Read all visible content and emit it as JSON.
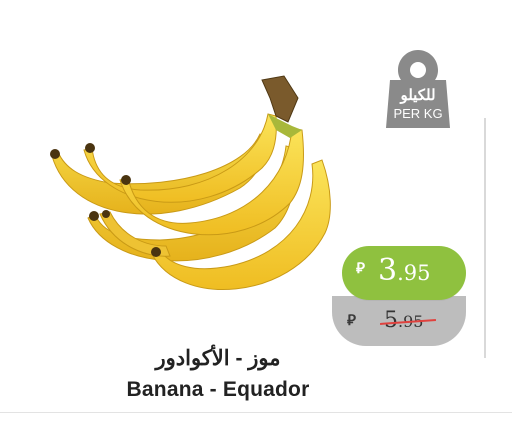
{
  "product": {
    "name_ar": "موز - الأكوادور",
    "name_en": "Banana - Equador",
    "image": "banana-bunch"
  },
  "unit_tag": {
    "label_ar": "للكيلو",
    "label_en": "PER KG",
    "icon": "weight-icon",
    "color": "#8a8a8a"
  },
  "price": {
    "currency_icon": "riyal-icon",
    "currency_symbol": "⃁",
    "current_int": "3",
    "current_dec": ".95",
    "previous_int": "5",
    "previous_dec": ".95",
    "current_color": "#8fc13f",
    "previous_color": "#bdbdbd",
    "strike_color": "#e0423e"
  }
}
